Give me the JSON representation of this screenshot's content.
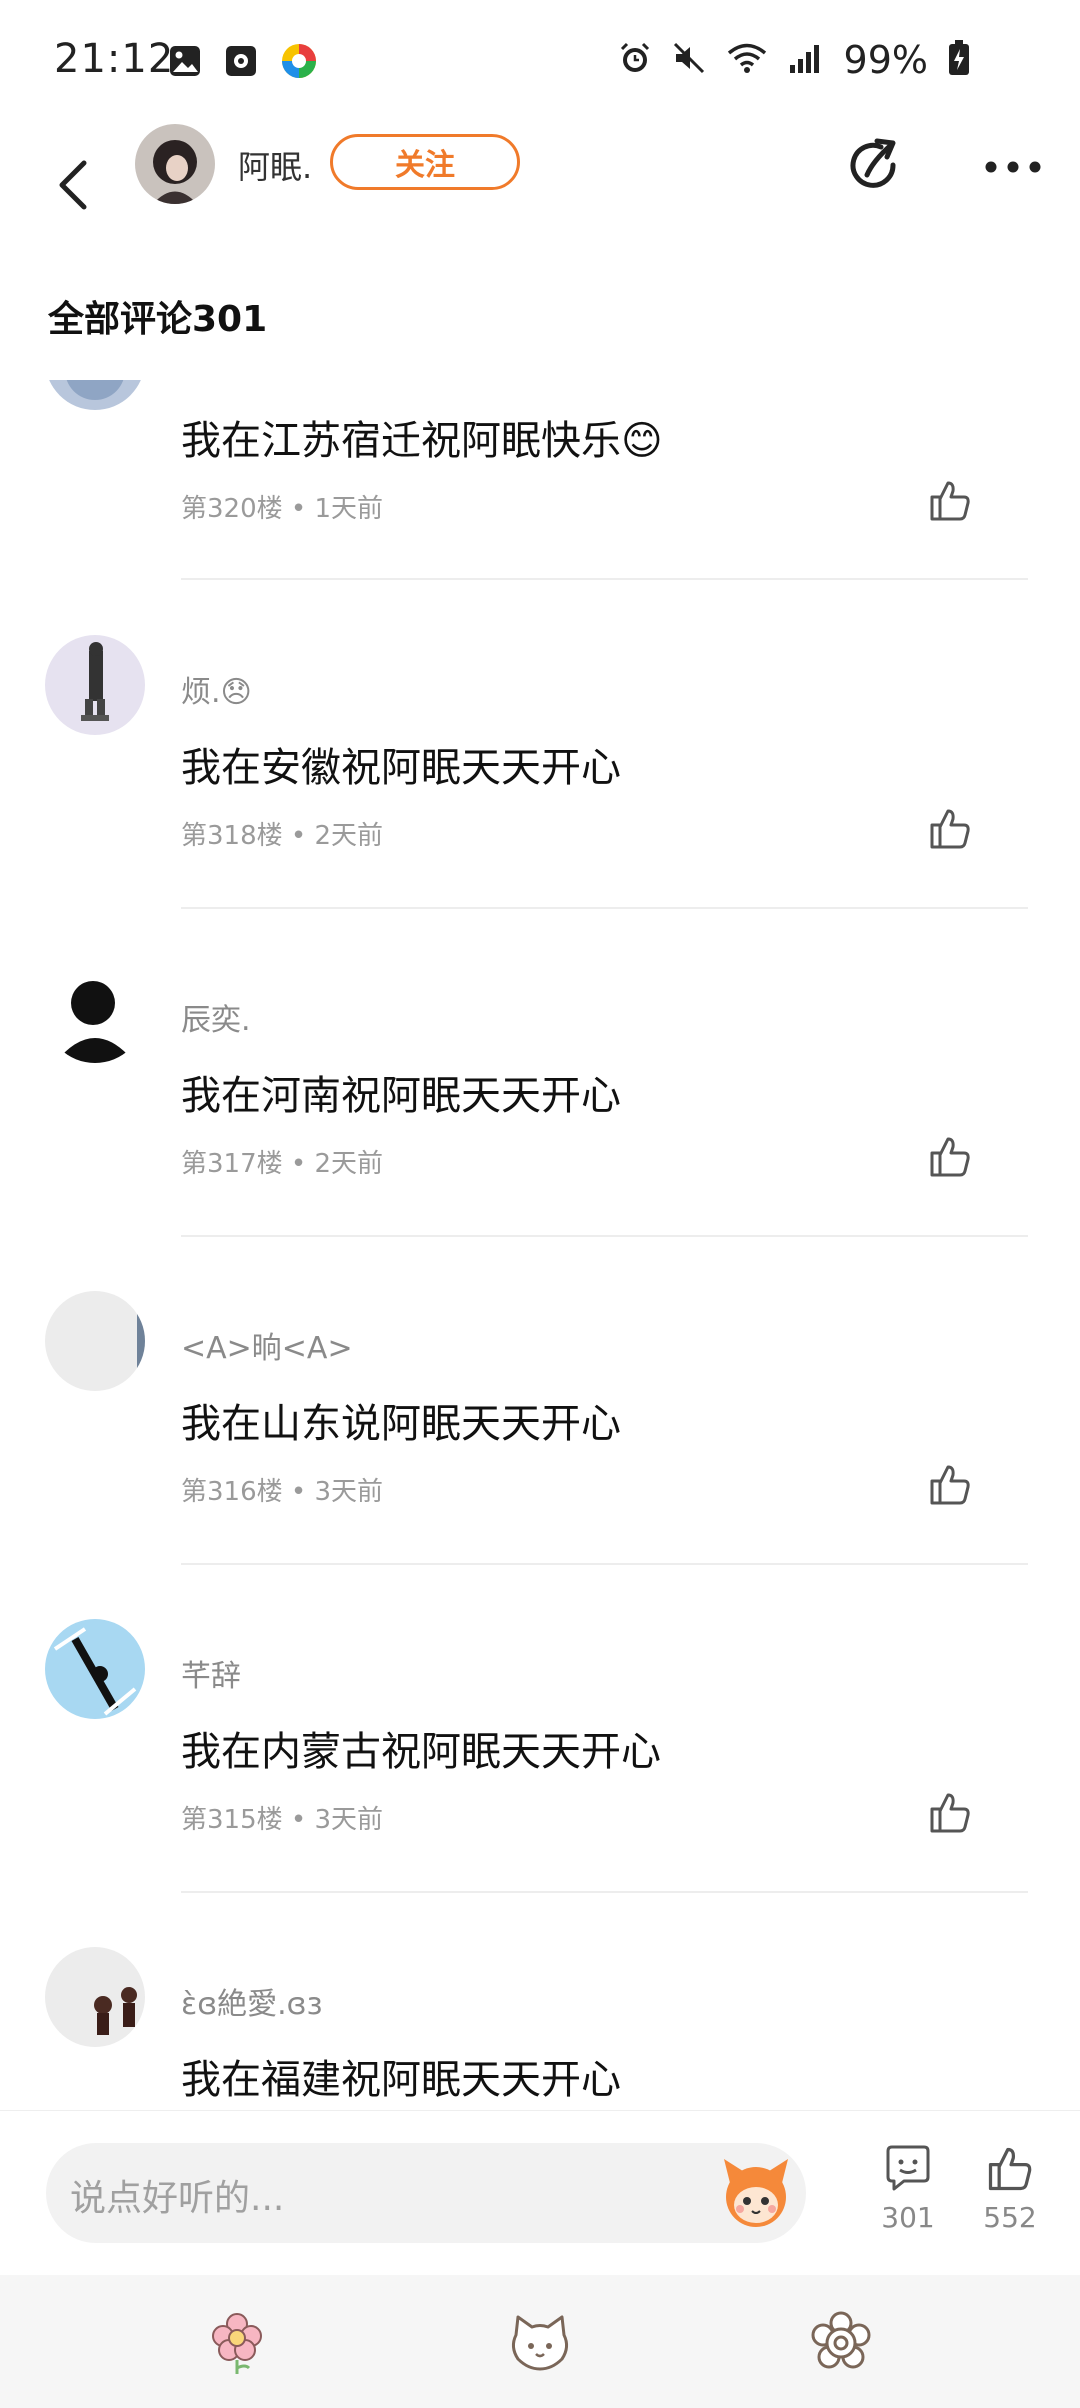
{
  "status_bar": {
    "time": "21:12",
    "battery": "99%",
    "icons": [
      "image-icon",
      "calendar-icon",
      "app-icon",
      "alarm-icon",
      "mute-icon",
      "wifi-icon",
      "signal-icon",
      "battery-charging-icon"
    ]
  },
  "header": {
    "username": "阿眠.",
    "follow_label": "关注",
    "icons": [
      "back-icon",
      "share-icon",
      "more-icon"
    ]
  },
  "comments": {
    "title": "全部评论301",
    "items": [
      {
        "name": "",
        "text": "我在江苏宿迁祝阿眠快乐😊",
        "meta": "第320楼 • 1天前"
      },
      {
        "name": "烦.😞",
        "text": "我在安徽祝阿眠天天开心",
        "meta": "第318楼 • 2天前"
      },
      {
        "name": "辰奕.",
        "text": "我在河南祝阿眠天天开心",
        "meta": "第317楼 • 2天前"
      },
      {
        "name": "<A>晌<A>",
        "text": "我在山东说阿眠天天开心",
        "meta": "第316楼 • 3天前"
      },
      {
        "name": "芊辞",
        "text": "我在内蒙古祝阿眠天天开心",
        "meta": "第315楼 • 3天前"
      },
      {
        "name": "ɛ̀ɞ絶愛.ɞɜ",
        "text": "我在福建祝阿眠天天开心",
        "meta": ""
      }
    ]
  },
  "input_bar": {
    "placeholder": "说点好听的...",
    "comment_count": "301",
    "like_count": "552"
  },
  "bottom_nav": {
    "items": [
      "flower-icon",
      "cat-face-icon",
      "settings-flower-icon"
    ]
  },
  "colors": {
    "accent": "#F07A2A",
    "text": "#111111",
    "muted": "#8a8a8a"
  }
}
